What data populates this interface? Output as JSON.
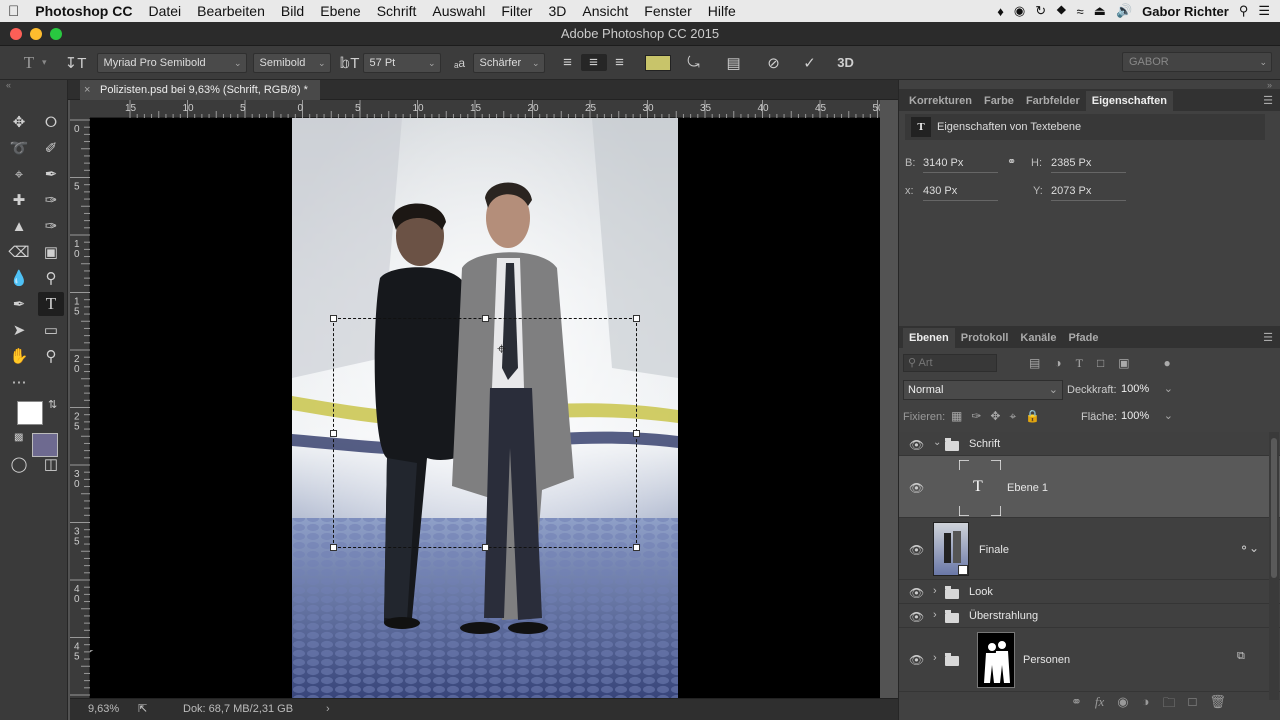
{
  "menubar": {
    "app": "Photoshop CC",
    "items": [
      "Datei",
      "Bearbeiten",
      "Bild",
      "Ebene",
      "Schrift",
      "Auswahl",
      "Filter",
      "3D",
      "Ansicht",
      "Fenster",
      "Hilfe"
    ],
    "user": "Gabor Richter"
  },
  "window": {
    "title": "Adobe Photoshop CC 2015"
  },
  "options": {
    "font_family": "Myriad Pro Semibold",
    "font_style": "Semibold",
    "font_size": "57 Pt",
    "antialias": "Schärfer",
    "text_color": "#c8c46a",
    "workspace": "GABOR"
  },
  "document": {
    "tab": "Polizisten.psd bei 9,63% (Schrift, RGB/8) *"
  },
  "rulers": {
    "h": [
      "15",
      "10",
      "5",
      "0",
      "5",
      "10",
      "15",
      "20",
      "25",
      "30",
      "35",
      "40",
      "45",
      "50"
    ],
    "v": [
      "0",
      "5",
      "1\n0",
      "1\n5",
      "2\n0",
      "2\n5",
      "3\n0",
      "3\n5",
      "4\n0",
      "4\n5",
      "5"
    ]
  },
  "status": {
    "zoom": "9,63%",
    "doc": "Dok: 68,7 MB/2,31 GB"
  },
  "props_panel": {
    "tabs": [
      "Korrekturen",
      "Farbe",
      "Farbfelder",
      "Eigenschaften"
    ],
    "heading": "Eigenschaften von Textebene",
    "b_label": "B:",
    "b_value": "3140 Px",
    "h_label": "H:",
    "h_value": "2385 Px",
    "x_label": "x:",
    "x_value": "430 Px",
    "y_label": "Y:",
    "y_value": "2073 Px"
  },
  "layers_panel": {
    "tabs": [
      "Ebenen",
      "Protokoll",
      "Kanäle",
      "Pfade"
    ],
    "filter": "Art",
    "blend_mode": "Normal",
    "opacity_label": "Deckkraft:",
    "opacity": "100%",
    "lock_label": "Fixieren:",
    "fill_label": "Fläche:",
    "fill": "100%",
    "layers": [
      {
        "name": "Schrift",
        "type": "group"
      },
      {
        "name": "Ebene 1",
        "type": "text"
      },
      {
        "name": "Finale",
        "type": "smart"
      },
      {
        "name": "Look",
        "type": "group"
      },
      {
        "name": "Überstrahlung",
        "type": "group"
      },
      {
        "name": "Personen",
        "type": "group"
      }
    ]
  }
}
